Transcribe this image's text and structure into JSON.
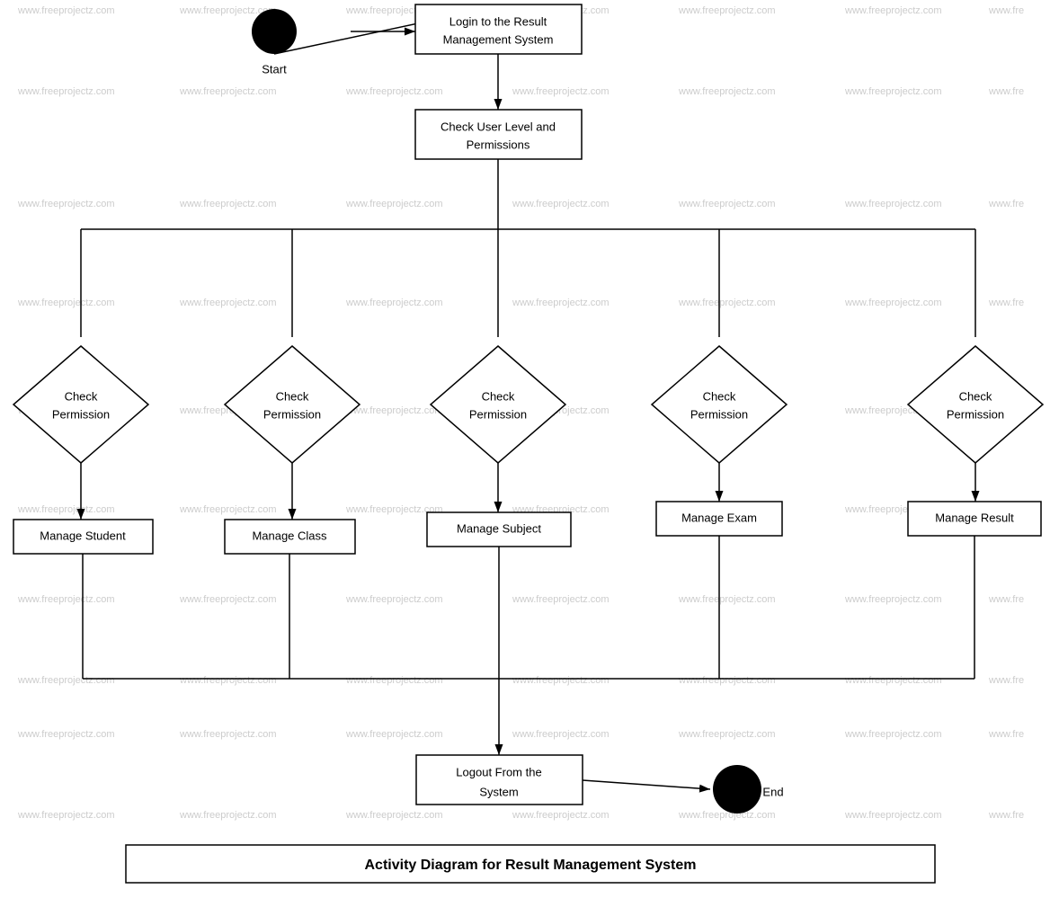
{
  "title": "Activity Diagram for Result Management System",
  "watermark": "www.freeprojectz.com",
  "nodes": {
    "start": {
      "label": "Start"
    },
    "login": {
      "label": "Login to the Result\nManagement System"
    },
    "checkPermissions": {
      "label": "Check User Level and\nPermissions"
    },
    "diamond1": {
      "label": "Check\nPermission"
    },
    "diamond2": {
      "label": "Check\nPermission"
    },
    "diamond3": {
      "label": "Check\nPermission"
    },
    "diamond4": {
      "label": "Check\nPermission"
    },
    "diamond5": {
      "label": "Check\nPermission"
    },
    "manageStudent": {
      "label": "Manage Student"
    },
    "manageClass": {
      "label": "Manage Class"
    },
    "manageSubject": {
      "label": "Manage Subject"
    },
    "manageExam": {
      "label": "Manage Exam"
    },
    "manageResult": {
      "label": "Manage Result"
    },
    "logout": {
      "label": "Logout From the\nSystem"
    },
    "end": {
      "label": "End"
    }
  },
  "footer": {
    "label": "Activity Diagram for Result Management System"
  }
}
